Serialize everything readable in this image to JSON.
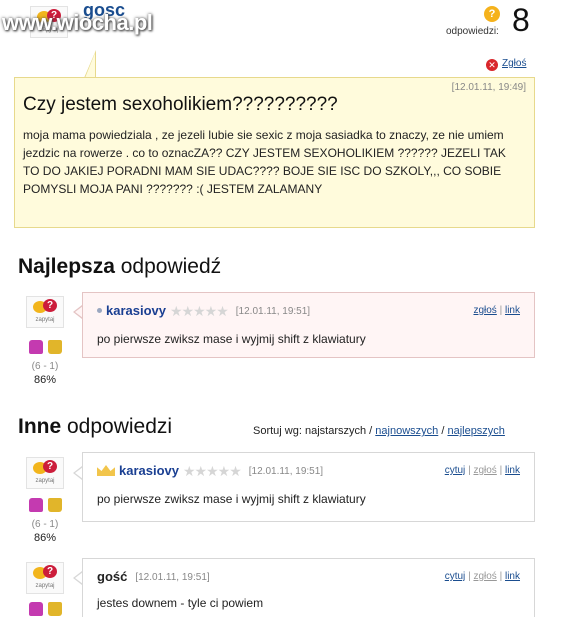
{
  "watermark": "www.wiocha.pl",
  "avatar_brand": "zapytaj",
  "question": {
    "author": "gosc",
    "answers_label": "odpowiedzi:",
    "answers_count": "8",
    "report_label": "Zgłoś",
    "date": "[12.01.11, 19:49]",
    "title": "Czy jestem sexoholikiem??????????",
    "body": "moja mama powiedziala , ze jezeli lubie sie sexic z moja sasiadka to znaczy, ze nie umiem jezdzic na rowerze . co to oznacZA?? CZY JESTEM SEXOHOLIKIEM ?????? JEZELI TAK TO DO JAKIEJ PORADNI MAM SIE UDAC???? BOJE SIE ISC DO SZKOLY,,, CO SOBIE POMYSLI MOJA PANI ??????? :( JESTEM ZALAMANY"
  },
  "best": {
    "heading_bold": "Najlepsza",
    "heading_rest": " odpowiedź",
    "votes": "(6 - 1)",
    "percent": "86%",
    "user": "karasiovy",
    "stars": "★★★★★",
    "date": "[12.01.11, 19:51]",
    "report": "zgłoś",
    "sep": "|",
    "link": "link",
    "text": "po pierwsze zwiksz mase i wyjmij shift z klawiatury"
  },
  "others": {
    "heading_bold": "Inne",
    "heading_rest": " odpowiedzi",
    "sort_label": "Sortuj wg: najstarszych /",
    "sort_newest": "najnowszych",
    "sort_sep": "/",
    "sort_best": "najlepszych",
    "items": [
      {
        "votes": "(6 - 1)",
        "percent": "86%",
        "user": "karasiovy",
        "stars": "★★★★★",
        "date": "[12.01.11, 19:51]",
        "quote": "cytuj",
        "report": "zgłoś",
        "link": "link",
        "text": "po pierwsze zwiksz mase i wyjmij shift z klawiatury"
      },
      {
        "user": "gość",
        "date": "[12.01.11, 19:51]",
        "quote": "cytuj",
        "report": "zgłoś",
        "link": "link",
        "text": "jestes downem - tyle ci powiem"
      }
    ],
    "sep": "|"
  }
}
